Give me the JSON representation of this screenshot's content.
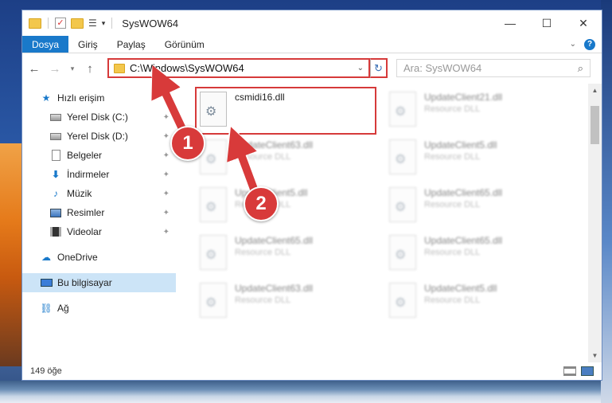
{
  "window": {
    "title": "SysWOW64",
    "controls": [
      "—",
      "☐",
      "✕"
    ]
  },
  "ribbon": {
    "tabs": [
      "Dosya",
      "Giriş",
      "Paylaş",
      "Görünüm"
    ]
  },
  "navbar": {
    "address": "C:\\Windows\\SysWOW64",
    "search_placeholder": "Ara: SysWOW64"
  },
  "sidebar": {
    "items": [
      {
        "label": "Hızlı erişim",
        "icon": "star-icon"
      },
      {
        "label": "Yerel Disk (C:)",
        "icon": "disk-icon"
      },
      {
        "label": "Yerel Disk (D:)",
        "icon": "disk-icon"
      },
      {
        "label": "Belgeler",
        "icon": "document-icon"
      },
      {
        "label": "İndirmeler",
        "icon": "download-icon"
      },
      {
        "label": "Müzik",
        "icon": "music-icon"
      },
      {
        "label": "Resimler",
        "icon": "pictures-icon"
      },
      {
        "label": "Videolar",
        "icon": "videos-icon"
      },
      {
        "label": "OneDrive",
        "icon": "cloud-icon"
      },
      {
        "label": "Bu bilgisayar",
        "icon": "computer-icon"
      },
      {
        "label": "Ağ",
        "icon": "network-icon"
      }
    ]
  },
  "files": [
    {
      "name": "csmidi16.dll",
      "type": ""
    },
    {
      "name": "UpdateClient21.dll",
      "type": "Resource DLL"
    },
    {
      "name": "UpdateClient63.dll",
      "type": "Resource DLL"
    },
    {
      "name": "UpdateClient5.dll",
      "type": "Resource DLL"
    },
    {
      "name": "UpdateClient5.dll",
      "type": "Resource DLL"
    },
    {
      "name": "UpdateClient65.dll",
      "type": "Resource DLL"
    },
    {
      "name": "UpdateClient65.dll",
      "type": "Resource DLL"
    },
    {
      "name": "UpdateClient65.dll",
      "type": "Resource DLL"
    },
    {
      "name": "UpdateClient63.dll",
      "type": "Resource DLL"
    },
    {
      "name": "UpdateClient5.dll",
      "type": "Resource DLL"
    }
  ],
  "status": {
    "item_count": "149 öğe"
  },
  "annotations": {
    "step1": "1",
    "step2": "2",
    "color": "#d83a3a"
  }
}
